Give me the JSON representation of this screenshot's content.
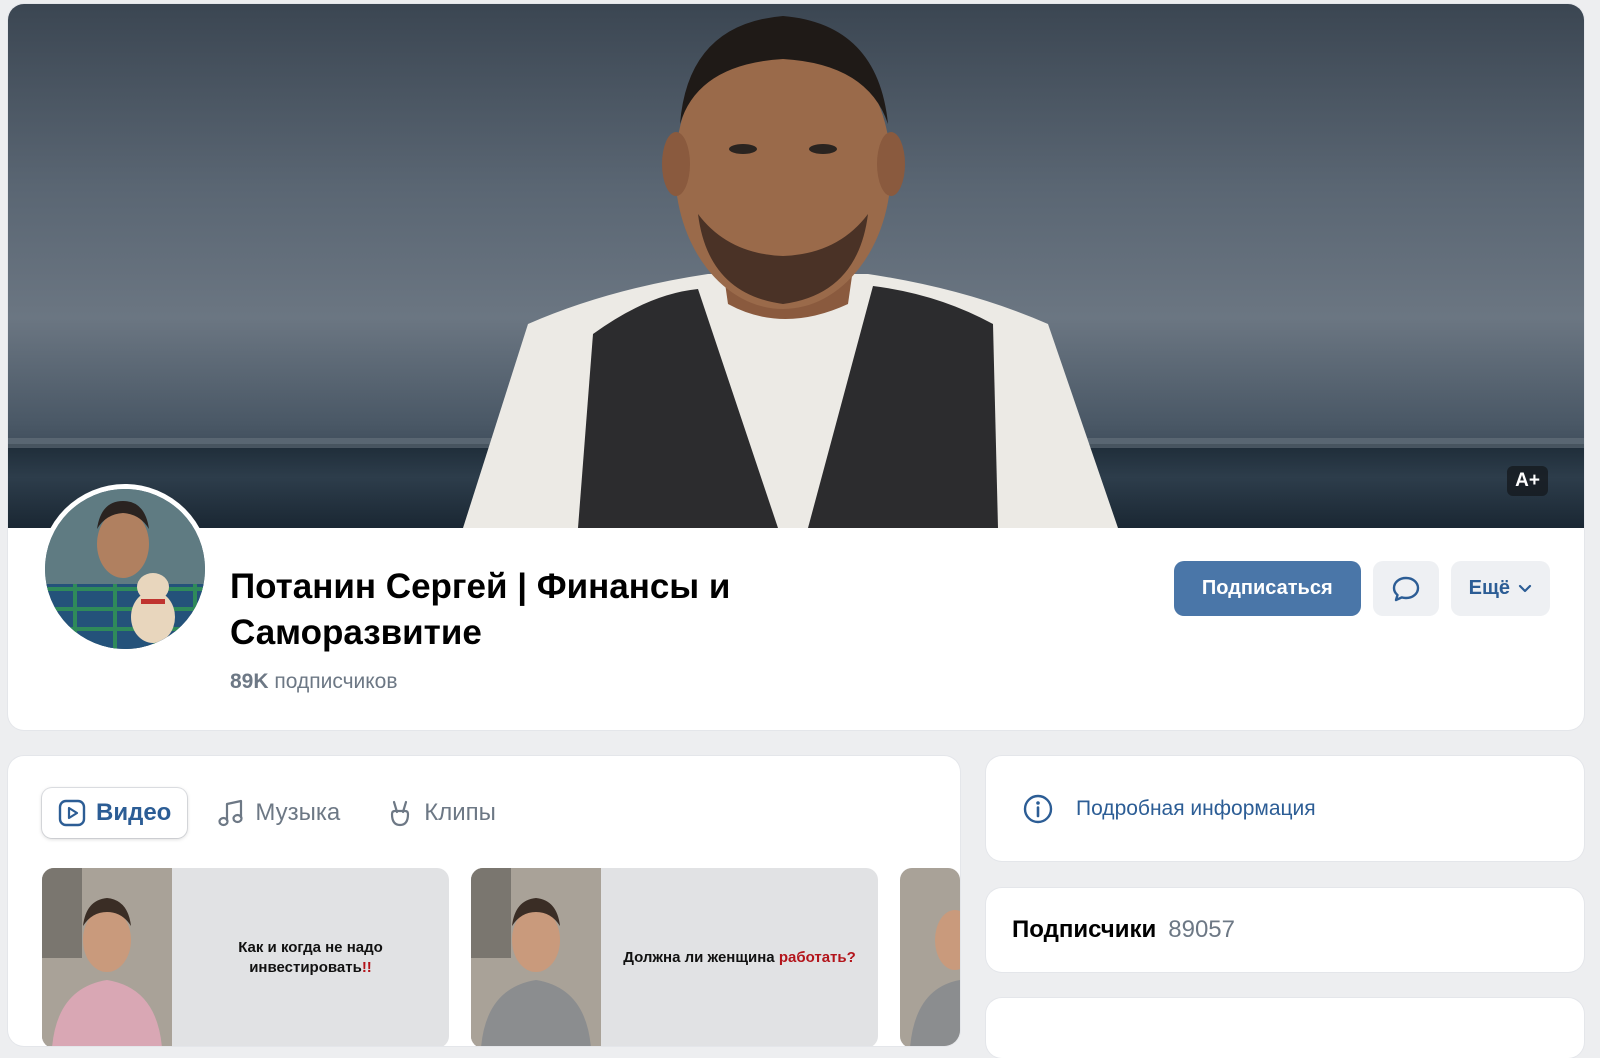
{
  "profile": {
    "name": "Потанин Сергей | Финансы и Саморазвитие",
    "subscribers_count": "89K",
    "subscribers_label": "подписчиков",
    "cover_badge": "A+"
  },
  "actions": {
    "subscribe_label": "Подписаться",
    "message_icon": "chat-bubble-icon",
    "more_label": "Ещё",
    "more_icon": "chevron-down-icon"
  },
  "tabs": [
    {
      "label": "Видео",
      "icon": "play-square-icon",
      "active": true
    },
    {
      "label": "Музыка",
      "icon": "music-note-icon",
      "active": false
    },
    {
      "label": "Клипы",
      "icon": "clips-hand-icon",
      "active": false
    }
  ],
  "videos": [
    {
      "caption_text": "Как и когда не надо инвестировать",
      "caption_mark": "!!",
      "sweater_color": "#d9a7b4"
    },
    {
      "caption_text": "Должна ли женщина ",
      "caption_mark": "работать?",
      "sweater_color": "#8b8d8f"
    }
  ],
  "sidebar": {
    "info_label": "Подробная информация",
    "info_icon": "info-circle-icon",
    "followers_title": "Подписчики",
    "followers_count": "89057"
  },
  "colors": {
    "accent": "#4a76a8",
    "link": "#2c5d95",
    "muted": "#6d7885",
    "background": "#edeef0"
  }
}
